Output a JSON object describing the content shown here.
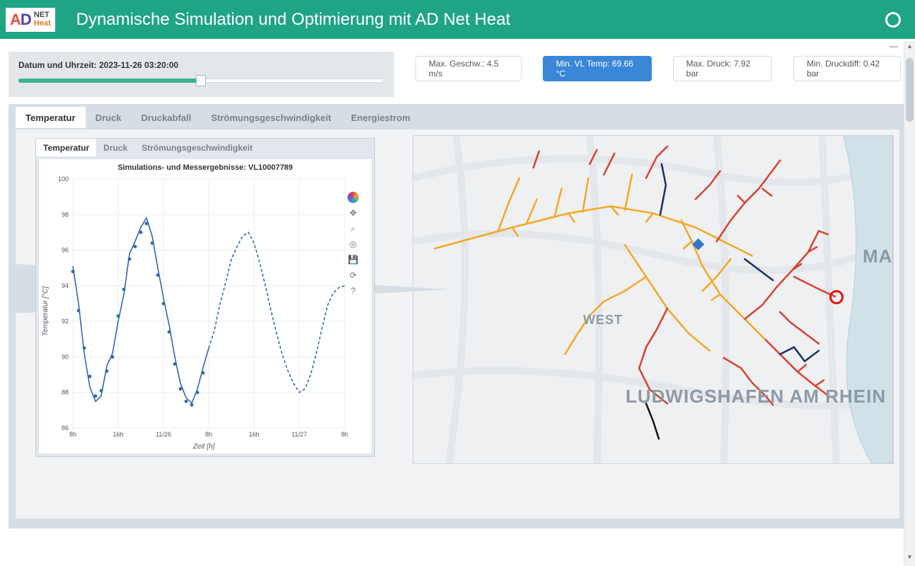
{
  "header": {
    "logo_text_net": "NET",
    "logo_text_heat": "Heat",
    "title": "Dynamische Simulation und Optimierung mit AD Net Heat"
  },
  "time_panel": {
    "label": "Datum und Uhrzeit: 2023-11-26 03:20:00",
    "slider_percent": 50
  },
  "metrics": {
    "max_speed": "Max. Geschw.: 4.5 m/s",
    "min_vl_temp": "Min. VL Temp: 69.66 °C",
    "max_pressure": "Max. Druck: 7.92 bar",
    "min_pdiff": "Min. Druckdiff: 0.42 bar"
  },
  "tabs_outer": [
    "Temperatur",
    "Druck",
    "Druckabfall",
    "Strömungsgeschwindigkeit",
    "Energiestrom"
  ],
  "tabs_inner": [
    "Temperatur",
    "Druck",
    "Strömungsgeschwindigkeit"
  ],
  "chart_panel": {
    "title": "Simulations- und Messergebnisse: VL10007789"
  },
  "map_labels": {
    "west": "WEST",
    "city": "LUDWIGSHAFEN AM RHEIN",
    "ma": "MA"
  },
  "chart_data": {
    "type": "line",
    "title": "Simulations- und Messergebnisse: VL10007789",
    "xlabel": "Zeit [h]",
    "ylabel": "Temperatur [°C]",
    "ylim": [
      86,
      100
    ],
    "x_ticks": [
      "8h",
      "16h",
      "11/26",
      "8h",
      "16h",
      "11/27",
      "8h"
    ],
    "y_ticks": [
      86,
      88,
      90,
      92,
      94,
      96,
      98,
      100
    ],
    "series": [
      {
        "name": "simulation_solid",
        "style": "solid",
        "x": [
          0,
          1,
          2,
          3,
          4,
          5,
          6,
          7,
          8,
          9,
          10,
          11,
          12,
          13,
          14,
          15,
          16,
          17,
          18,
          19,
          20,
          21,
          22,
          23,
          24
        ],
        "y": [
          95.1,
          93.0,
          90.2,
          88.3,
          87.5,
          87.8,
          89.5,
          90.2,
          92.0,
          93.5,
          95.8,
          96.5,
          97.3,
          97.8,
          96.8,
          95.0,
          93.3,
          91.8,
          90.0,
          88.5,
          87.7,
          87.4,
          88.2,
          89.4,
          90.5
        ]
      },
      {
        "name": "simulation_dashed",
        "style": "dashed",
        "x": [
          24,
          25,
          26,
          27,
          28,
          29,
          30,
          31,
          32,
          33,
          34,
          35,
          36,
          37,
          38,
          39,
          40,
          41,
          42,
          43,
          44,
          45,
          46,
          47,
          48
        ],
        "y": [
          90.5,
          91.5,
          93.0,
          94.2,
          95.5,
          96.2,
          96.8,
          97.0,
          96.4,
          95.3,
          94.0,
          92.6,
          91.3,
          90.1,
          89.2,
          88.5,
          88.0,
          88.2,
          89.0,
          90.2,
          91.6,
          92.9,
          93.6,
          93.9,
          94.0
        ]
      },
      {
        "name": "measurements",
        "style": "scatter",
        "x": [
          0,
          1,
          2,
          3,
          4,
          5,
          6,
          7,
          8,
          9,
          10,
          11,
          12,
          13,
          14,
          15,
          16,
          17,
          18,
          19,
          20,
          21,
          22,
          23
        ],
        "y": [
          94.8,
          92.6,
          90.5,
          88.9,
          87.8,
          88.1,
          89.2,
          90.0,
          92.3,
          93.8,
          95.5,
          96.2,
          97.0,
          97.5,
          96.4,
          94.6,
          93.0,
          91.4,
          89.6,
          88.2,
          87.5,
          87.3,
          88.0,
          89.1
        ]
      }
    ]
  }
}
